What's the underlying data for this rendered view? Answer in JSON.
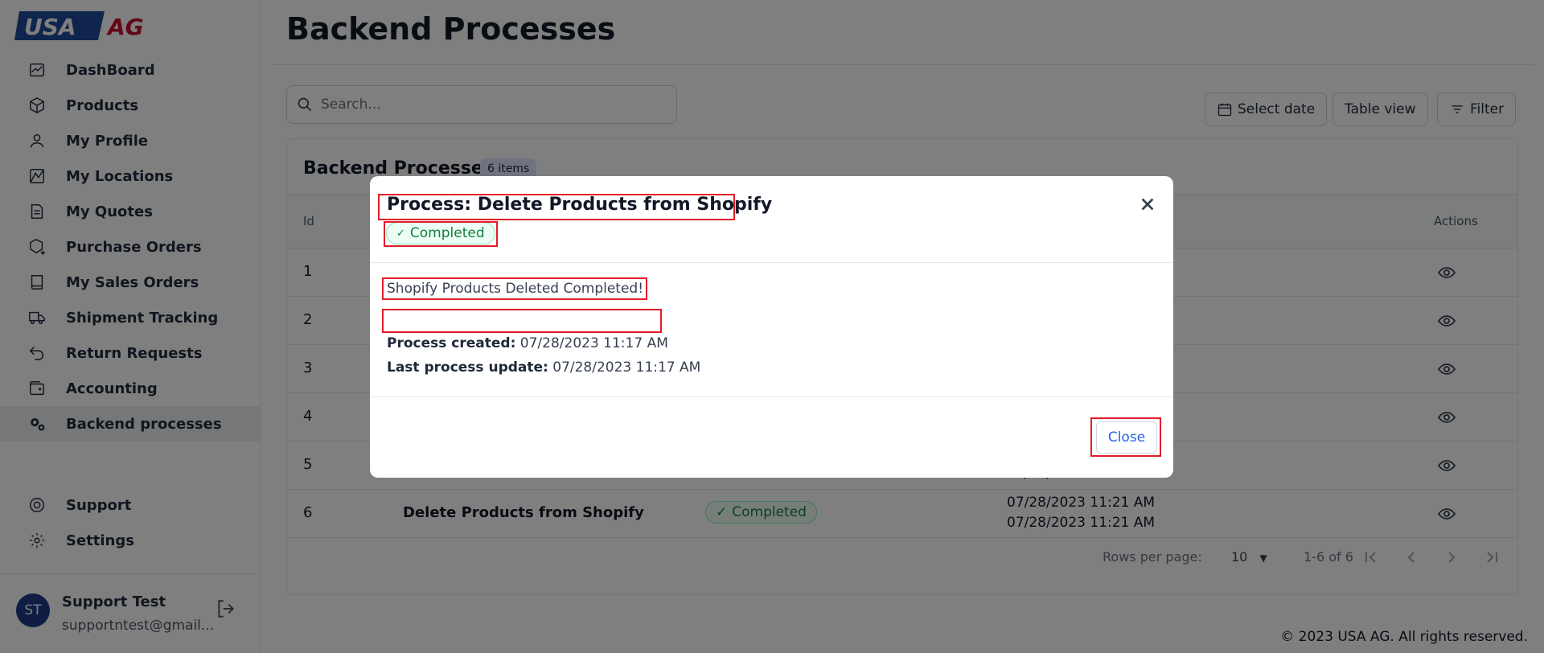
{
  "brand": {
    "logo_left": "USA",
    "logo_right": "AG",
    "colors": {
      "blue": "#1e4b9b",
      "red": "#c8102e"
    }
  },
  "sidebar": {
    "items": [
      {
        "label": "DashBoard",
        "icon": "chart-icon"
      },
      {
        "label": "Products",
        "icon": "box-icon"
      },
      {
        "label": "My Profile",
        "icon": "user-icon"
      },
      {
        "label": "My Locations",
        "icon": "map-icon"
      },
      {
        "label": "My Quotes",
        "icon": "document-icon"
      },
      {
        "label": "Purchase Orders",
        "icon": "box-plus-icon"
      },
      {
        "label": "My Sales Orders",
        "icon": "book-icon"
      },
      {
        "label": "Shipment Tracking",
        "icon": "truck-icon"
      },
      {
        "label": "Return Requests",
        "icon": "return-icon"
      },
      {
        "label": "Accounting",
        "icon": "wallet-icon"
      },
      {
        "label": "Backend processes",
        "icon": "gears-icon",
        "active": true
      }
    ],
    "bottom_items": [
      {
        "label": "Support",
        "icon": "lifebuoy-icon"
      },
      {
        "label": "Settings",
        "icon": "gear-icon"
      }
    ],
    "user": {
      "initials": "ST",
      "name": "Support Test",
      "email": "supportntest@gmail..."
    }
  },
  "main": {
    "title": "Backend Processes",
    "search_placeholder": "Search...",
    "toolbar": {
      "select_date": "Select date",
      "table_view": "Table view",
      "filter": "Filter"
    },
    "table": {
      "title": "Backend Processes",
      "badge": "6 items",
      "headers": {
        "id": "Id",
        "actions": "Actions"
      },
      "rows": [
        {
          "id": "1"
        },
        {
          "id": "2"
        },
        {
          "id": "3"
        },
        {
          "id": "4"
        },
        {
          "id": "5",
          "date_partial": "07/28/2023 11:21 AM"
        },
        {
          "id": "6",
          "name": "Delete Products from Shopify",
          "status": "Completed",
          "created": "07/28/2023 11:21 AM",
          "updated": "07/28/2023 11:21 AM"
        }
      ],
      "pagination": {
        "rows_per_page_label": "Rows per page:",
        "rows_per_page": "10",
        "range": "1-6 of 6"
      }
    },
    "footer": "© 2023 USA AG. All rights reserved."
  },
  "modal": {
    "title": "Process: Delete Products from Shopify",
    "status": "Completed",
    "message": "Shopify Products Deleted Completed!",
    "created_label": "Process created:",
    "created_value": "07/28/2023 11:17 AM",
    "updated_label": "Last process update:",
    "updated_value": "07/28/2023 11:17 AM",
    "close_label": "Close"
  }
}
